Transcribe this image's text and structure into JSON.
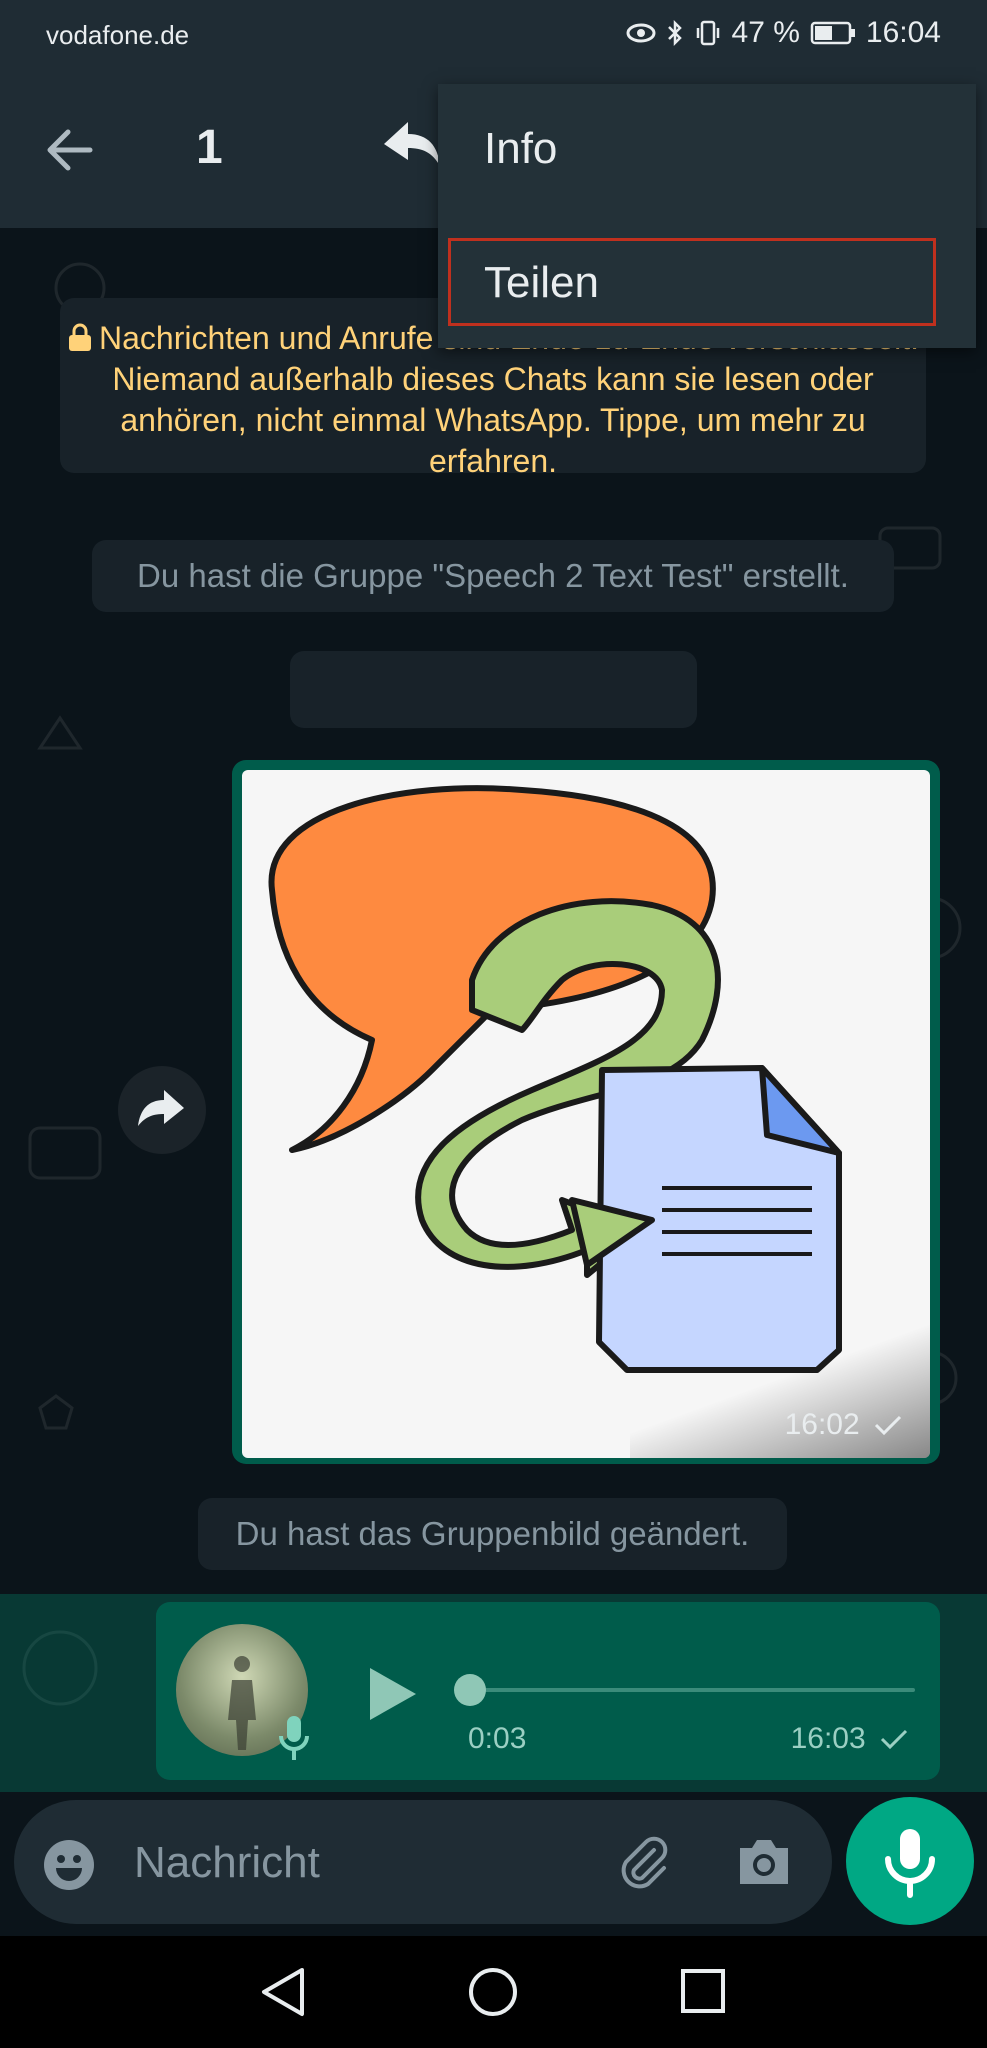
{
  "status_bar": {
    "carrier": "vodafone.de",
    "battery": "47 %",
    "time": "16:04"
  },
  "top_bar": {
    "selected_count": "1"
  },
  "menu": {
    "items": [
      "Info",
      "Teilen"
    ]
  },
  "chat": {
    "encryption_notice": "Nachrichten und Anrufe sind Ende-zu-Ende-verschlüsselt. Niemand außerhalb dieses Chats kann sie lesen oder anhören, nicht einmal WhatsApp. Tippe, um mehr zu erfahren.",
    "group_created": "Du hast die Gruppe \"Speech 2 Text Test\" erstellt.",
    "image_message_time": "16:02",
    "group_picture_changed": "Du hast das Gruppenbild geändert.",
    "audio_message": {
      "duration": "0:03",
      "time": "16:03",
      "progress": 0
    }
  },
  "composer": {
    "placeholder": "Nachricht"
  },
  "colors": {
    "header": "#1f2c34",
    "chat_background": "#0b141a",
    "outgoing_bubble": "#005c4b",
    "accent": "#00a884",
    "encryption_text": "#ffd279",
    "highlight_outline": "#c0301e"
  },
  "icons": [
    "arrow-back-icon",
    "reply-icon",
    "forward-icon",
    "play-icon",
    "mic-icon",
    "emoji-icon",
    "attach-icon",
    "camera-icon",
    "lock-icon",
    "check-icon"
  ]
}
